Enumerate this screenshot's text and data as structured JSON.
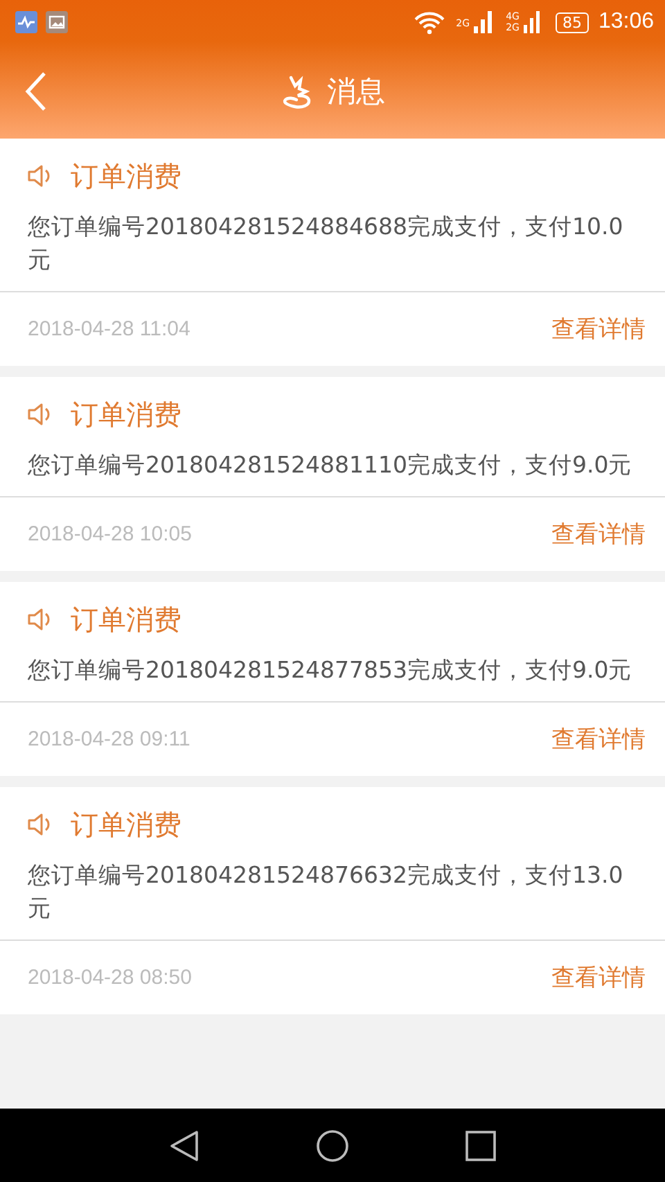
{
  "status_bar": {
    "signal_1_label": "2G",
    "signal_2_labels": [
      "4G",
      "2G"
    ],
    "battery": "85",
    "time": "13:06"
  },
  "header": {
    "title": "消息"
  },
  "messages": [
    {
      "title": "订单消费",
      "body": "您订单编号201804281524884688完成支付，支付10.0元",
      "time": "2018-04-28 11:04",
      "link": "查看详情"
    },
    {
      "title": "订单消费",
      "body": "您订单编号201804281524881110完成支付，支付9.0元",
      "time": "2018-04-28 10:05",
      "link": "查看详情"
    },
    {
      "title": "订单消费",
      "body": "您订单编号201804281524877853完成支付，支付9.0元",
      "time": "2018-04-28 09:11",
      "link": "查看详情"
    },
    {
      "title": "订单消费",
      "body": "您订单编号201804281524876632完成支付，支付13.0元",
      "time": "2018-04-28 08:50",
      "link": "查看详情"
    }
  ]
}
